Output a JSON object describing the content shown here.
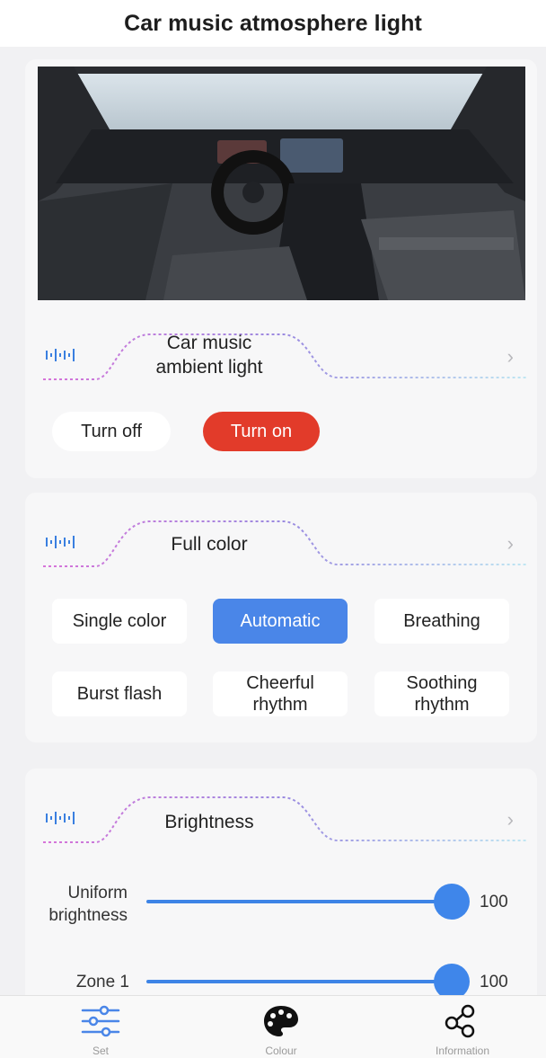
{
  "header": {
    "title": "Car music atmosphere light"
  },
  "ambient": {
    "title_line1": "Car music",
    "title_line2": "ambient light",
    "turn_off_label": "Turn off",
    "turn_on_label": "Turn on",
    "state": "on"
  },
  "color_mode": {
    "title": "Full color",
    "modes": [
      {
        "line1": "Single color",
        "line2": ""
      },
      {
        "line1": "Automatic",
        "line2": ""
      },
      {
        "line1": "Breathing",
        "line2": ""
      },
      {
        "line1": "Burst flash",
        "line2": ""
      },
      {
        "line1": "Cheerful",
        "line2": "rhythm"
      },
      {
        "line1": "Soothing",
        "line2": "rhythm"
      }
    ],
    "selected": "Automatic"
  },
  "brightness": {
    "title": "Brightness",
    "sliders": [
      {
        "label_line1": "Uniform",
        "label_line2": "brightness",
        "value": "100",
        "level": 100
      },
      {
        "label_line1": "Zone 1",
        "label_line2": "",
        "value": "100",
        "level": 100
      }
    ]
  },
  "tabs": [
    {
      "label": "Set",
      "icon": "sliders-icon"
    },
    {
      "label": "Colour",
      "icon": "palette-icon"
    },
    {
      "label": "Information",
      "icon": "share-nodes-icon"
    }
  ],
  "colors": {
    "accent_blue": "#4a86e8",
    "on_red": "#e23b2a",
    "wave_pink": "#d774d9",
    "wave_cyan": "#7fc9e8"
  }
}
